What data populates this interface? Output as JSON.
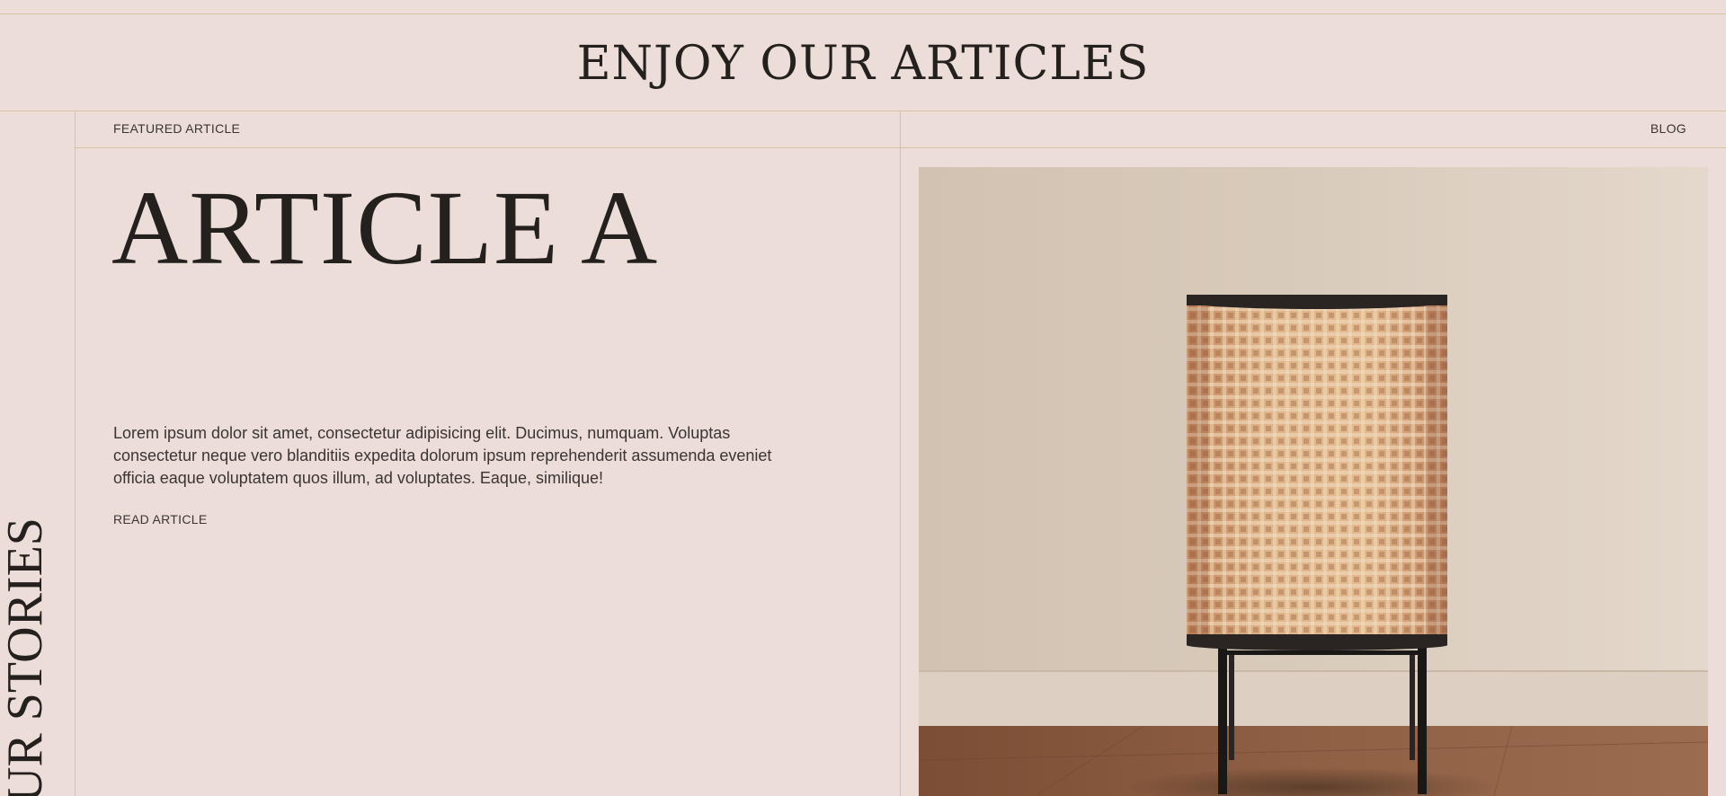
{
  "header": {
    "title": "ENJOY OUR ARTICLES"
  },
  "featured": {
    "label": "FEATURED ARTICLE",
    "blog_link": "BLOG",
    "title": "ARTICLE A",
    "excerpt": "Lorem ipsum dolor sit amet, consectetur adipisicing elit. Ducimus, numquam. Voluptas consectetur neque vero blanditiis expedita dolorum ipsum reprehenderit assumenda eveniet officia eaque voluptatem quos illum, ad voluptates. Eaque, similique!",
    "read_link": "READ ARTICLE"
  },
  "side": {
    "vertical_text": "UR STORIES"
  },
  "image": {
    "subject": "rattan-lamp",
    "colors": {
      "wall": "#d9cbbb",
      "floor": "#8a5a3e",
      "shade": "#d8a97a",
      "metal": "#1a1817"
    }
  },
  "colors": {
    "background": "#ecddd8",
    "rule": "#d6c3a3",
    "text": "#24201e"
  }
}
